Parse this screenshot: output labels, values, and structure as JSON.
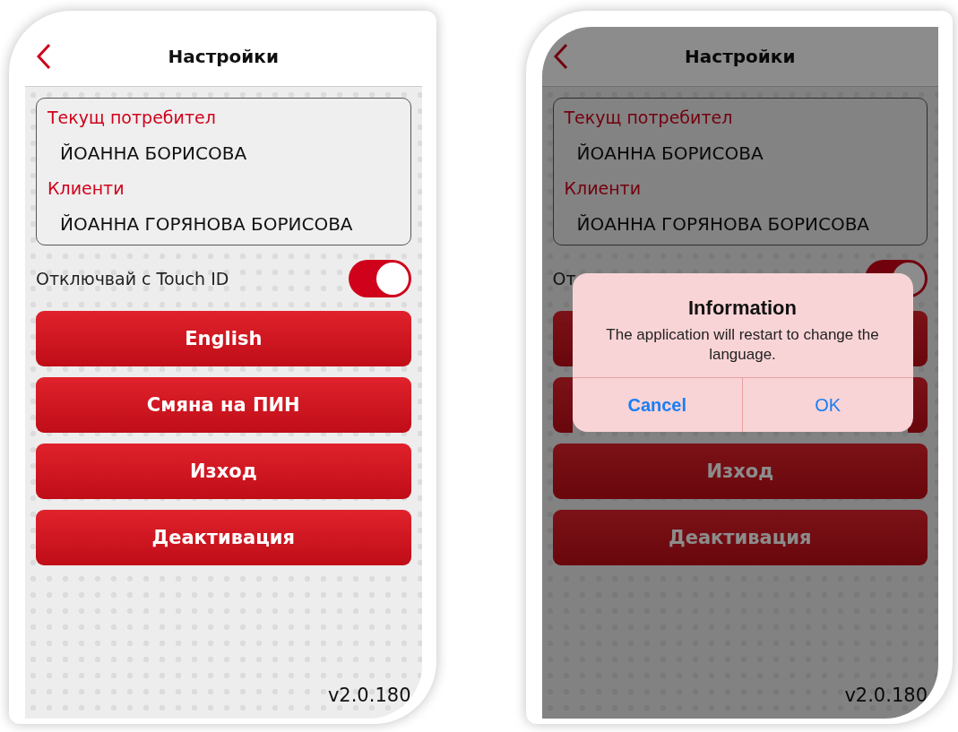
{
  "screens": [
    {
      "title": "Настройки",
      "current_user_label": "Текущ потребител",
      "current_user": "ЙОАННА БОРИСОВА",
      "clients_label": "Клиенти",
      "client": "ЙОАННА ГОРЯНОВА БОРИСОВА",
      "touch_id": {
        "label": "Отключвай с Touch ID",
        "on": true
      },
      "buttons": [
        {
          "label": "English"
        },
        {
          "label": "Смяна на ПИН"
        },
        {
          "label": "Изход"
        },
        {
          "label": "Деактивация"
        }
      ],
      "version": "v2.0.180"
    },
    {
      "title": "Настройки",
      "current_user_label": "Текущ потребител",
      "current_user": "ЙОАННА БОРИСОВА",
      "clients_label": "Клиенти",
      "client": "ЙОАННА ГОРЯНОВА БОРИСОВА",
      "touch_id": {
        "label": "От",
        "on": true
      },
      "buttons": [
        {
          "covered": true
        },
        {
          "covered": true
        },
        {
          "label": "Изход"
        },
        {
          "label": "Деактивация"
        }
      ],
      "version": "v2.0.180",
      "dialog": {
        "title": "Information",
        "message": "The application will restart to change the language.",
        "actions": [
          {
            "label": "Cancel",
            "kind": "cancel"
          },
          {
            "label": "OK",
            "kind": "default"
          }
        ]
      }
    }
  ]
}
